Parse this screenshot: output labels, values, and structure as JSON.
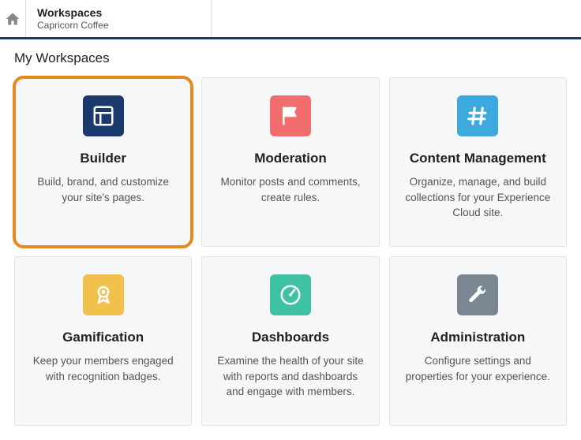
{
  "header": {
    "title": "Workspaces",
    "subtitle": "Capricorn Coffee"
  },
  "section_title": "My Workspaces",
  "tiles": [
    {
      "id": "builder",
      "title": "Builder",
      "desc": "Build, brand, and customize your site's pages.",
      "color": "#1b3a6b",
      "highlighted": true
    },
    {
      "id": "moderation",
      "title": "Moderation",
      "desc": "Monitor posts and comments, create rules.",
      "color": "#f26d6d",
      "highlighted": false
    },
    {
      "id": "content-management",
      "title": "Content Management",
      "desc": "Organize, manage, and build collections for your Experience Cloud site.",
      "color": "#3ea9dd",
      "highlighted": false
    },
    {
      "id": "gamification",
      "title": "Gamification",
      "desc": "Keep your members engaged with recognition badges.",
      "color": "#f0c14b",
      "highlighted": false
    },
    {
      "id": "dashboards",
      "title": "Dashboards",
      "desc": "Examine the health of your site with reports and dashboards and engage with members.",
      "color": "#3fc1a3",
      "highlighted": false
    },
    {
      "id": "administration",
      "title": "Administration",
      "desc": "Configure settings and properties for your experience.",
      "color": "#7a8793",
      "highlighted": false
    }
  ]
}
